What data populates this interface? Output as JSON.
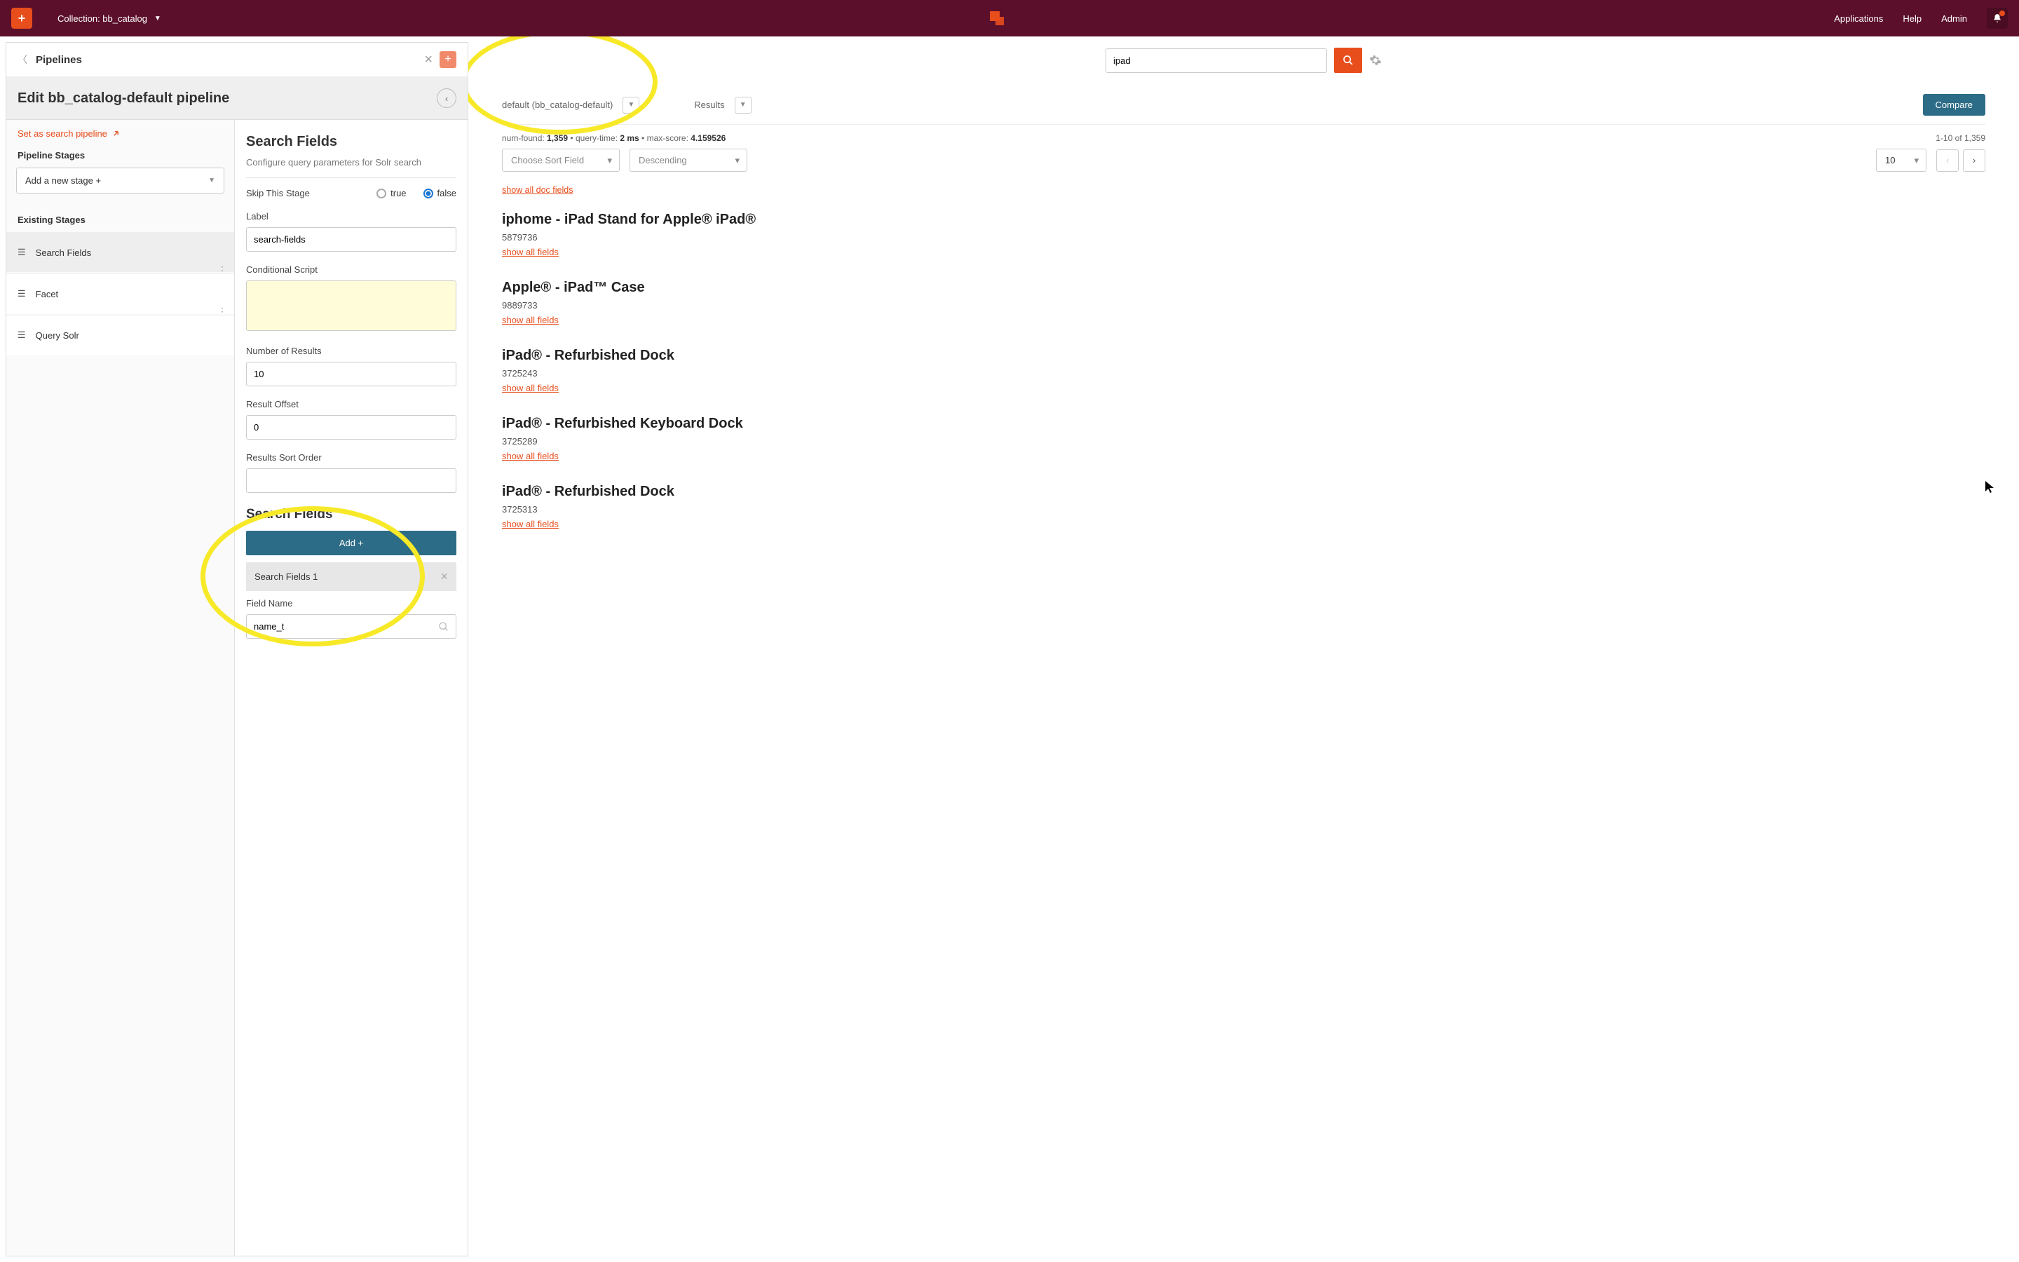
{
  "topbar": {
    "collection_label": "Collection: bb_catalog",
    "nav": {
      "applications": "Applications",
      "help": "Help",
      "admin": "Admin"
    }
  },
  "panel": {
    "title": "Pipelines",
    "edit_title": "Edit bb_catalog-default pipeline",
    "set_search": "Set as search pipeline",
    "stages_title": "Pipeline Stages",
    "add_stage_placeholder": "Add a new stage +",
    "existing_title": "Existing Stages",
    "stages": [
      {
        "label": "Search Fields"
      },
      {
        "label": "Facet"
      },
      {
        "label": "Query Solr"
      }
    ]
  },
  "config": {
    "heading": "Search Fields",
    "subtitle": "Configure query parameters for Solr search",
    "skip_label": "Skip This Stage",
    "radio_true": "true",
    "radio_false": "false",
    "label_label": "Label",
    "label_value": "search-fields",
    "cond_label": "Conditional Script",
    "cond_value": "",
    "numres_label": "Number of Results",
    "numres_value": "10",
    "offset_label": "Result Offset",
    "offset_value": "0",
    "sort_label": "Results Sort Order",
    "sort_value": "",
    "sf_heading": "Search Fields",
    "add_btn": "Add +",
    "sf1_label": "Search Fields 1",
    "fieldname_label": "Field Name",
    "fieldname_value": "name_t"
  },
  "search": {
    "value": "ipad"
  },
  "compare": {
    "pipeline_label": "default (bb_catalog-default)",
    "results_label": "Results",
    "compare_btn": "Compare"
  },
  "meta": {
    "numfound_label": "num-found:",
    "numfound": "1,359",
    "querytime_label": "query-time:",
    "querytime": "2 ms",
    "maxscore_label": "max-score:",
    "maxscore": "4.159526",
    "range": "1-10 of 1,359"
  },
  "controls": {
    "sortfield": "Choose Sort Field",
    "direction": "Descending",
    "pagesize": "10"
  },
  "links": {
    "show_all_doc": "show all doc fields",
    "show_all_fields": "show all fields"
  },
  "results": [
    {
      "title": "iphome - iPad Stand for Apple® iPad®",
      "id": "5879736"
    },
    {
      "title": "Apple® - iPad™ Case",
      "id": "9889733"
    },
    {
      "title": "iPad® - Refurbished Dock",
      "id": "3725243"
    },
    {
      "title": "iPad® - Refurbished Keyboard Dock",
      "id": "3725289"
    },
    {
      "title": "iPad® - Refurbished Dock",
      "id": "3725313"
    }
  ]
}
